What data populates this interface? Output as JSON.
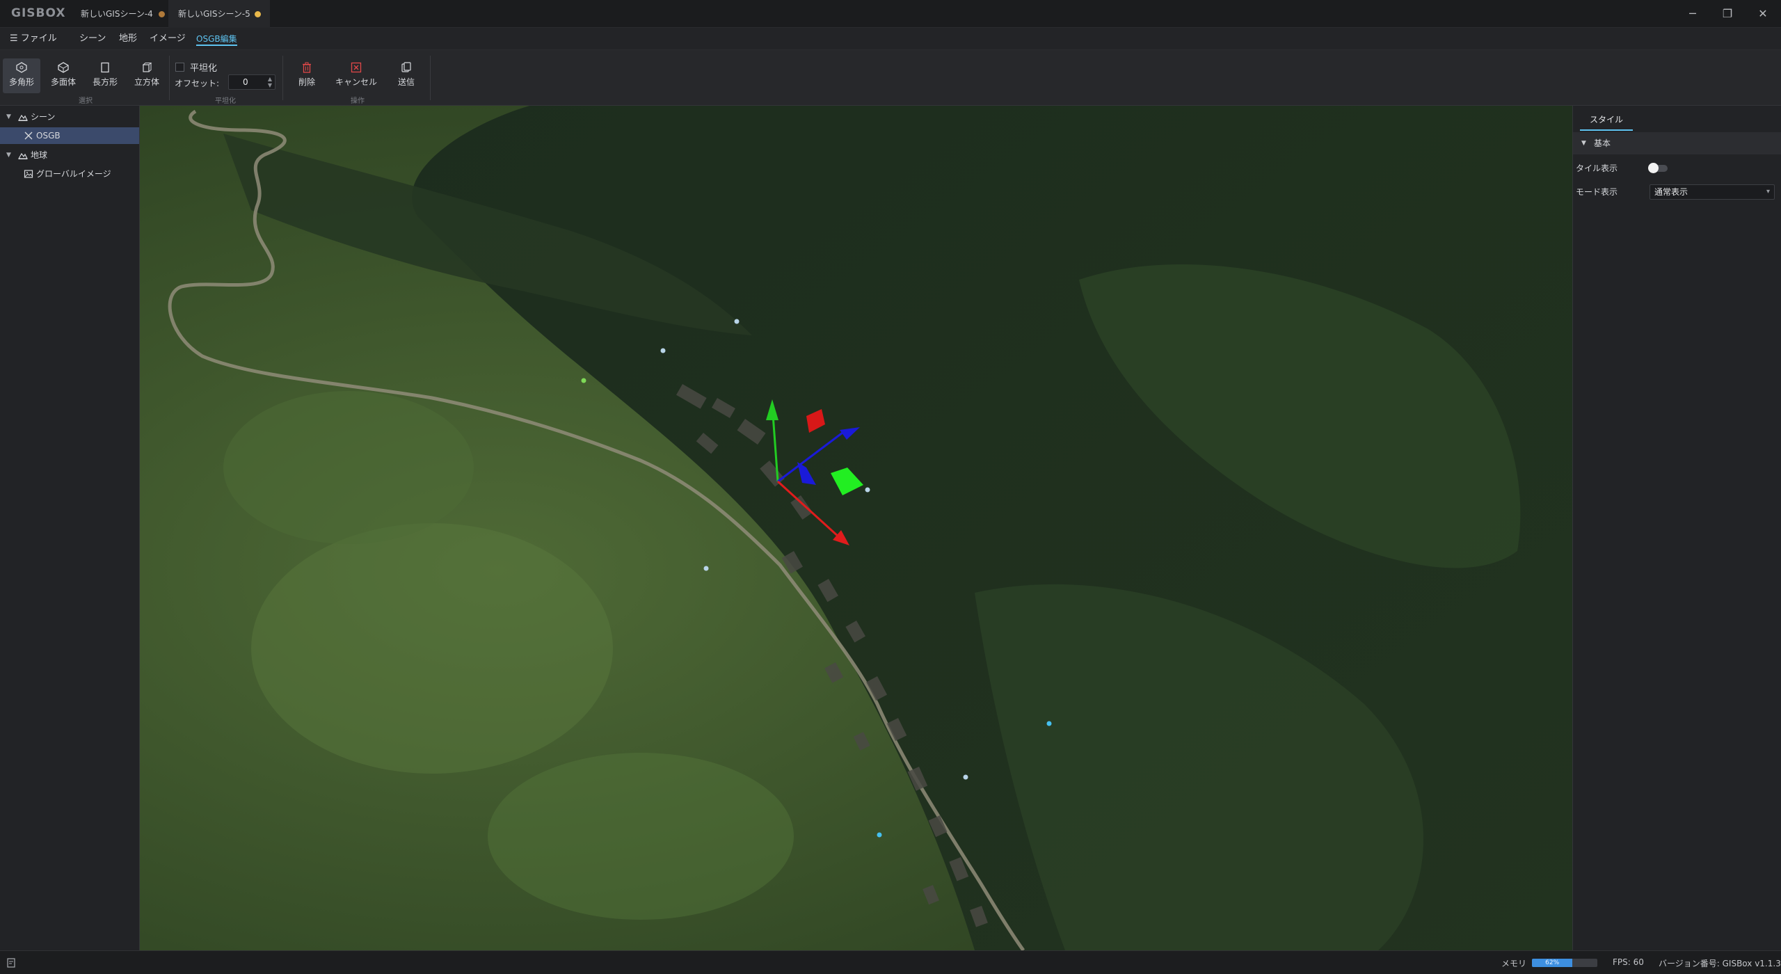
{
  "app": {
    "logo": "GISBOX",
    "tabs": [
      {
        "label": "新しいGISシーン-4",
        "dot_color": "#b07a3a"
      },
      {
        "label": "新しいGISシーン-5",
        "dot_color": "#e8b84a"
      }
    ],
    "window_controls": {
      "minimize": "─",
      "restore": "❐",
      "close": "✕"
    }
  },
  "menubar": {
    "file": "☰ ファイル",
    "items": [
      "シーン",
      "地形",
      "イメージ",
      "OSGB編集"
    ],
    "active": "OSGB編集"
  },
  "ribbon": {
    "select_group": {
      "label": "選択",
      "buttons": [
        "多角形",
        "多面体",
        "長方形",
        "立方体"
      ],
      "active": "多角形"
    },
    "flatten_group": {
      "label": "平坦化",
      "checkbox_label": "平坦化",
      "checked": false,
      "offset_label": "オフセット:",
      "offset_value": "0"
    },
    "operation_group": {
      "label": "操作",
      "buttons": [
        "削除",
        "キャンセル",
        "送信"
      ]
    }
  },
  "left_panel": {
    "tree": [
      {
        "label": "シーン",
        "icon": "scene-icon",
        "expandable": true
      },
      {
        "label": "OSGB",
        "icon": "osgb-icon",
        "selected": true
      },
      {
        "label": "地球",
        "icon": "globe-icon",
        "expandable": true
      },
      {
        "label": "グローバルイメージ",
        "icon": "image-icon"
      }
    ]
  },
  "viewport": {
    "gizmo_colors": {
      "x": "#e01c1c",
      "y": "#22cc22",
      "z": "#1a1ad8"
    },
    "markers_color": "#6ec3e0"
  },
  "right_panel": {
    "tab": "スタイル",
    "section": "基本",
    "rows": [
      {
        "label": "タイル表示",
        "type": "toggle",
        "value": false
      },
      {
        "label": "モード表示",
        "type": "select",
        "value": "通常表示"
      }
    ]
  },
  "statusbar": {
    "memory_label": "メモリ",
    "memory_percent": 62,
    "memory_text": "62%",
    "fps": "FPS: 60",
    "version": "バージョン番号: GISBox v1.1.3"
  }
}
